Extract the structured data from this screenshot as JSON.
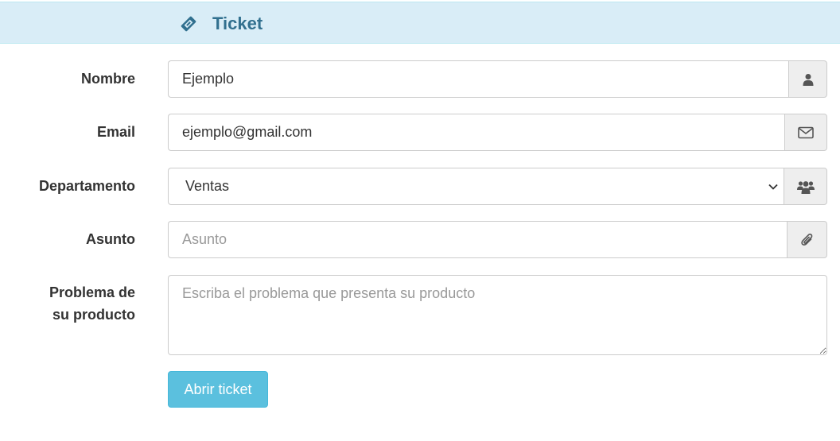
{
  "header": {
    "title": "Ticket",
    "icon": "ticket-icon",
    "background": "#d9edf7",
    "title_color": "#31708f"
  },
  "form": {
    "nombre": {
      "label": "Nombre",
      "value": "Ejemplo",
      "icon": "user-icon"
    },
    "email": {
      "label": "Email",
      "value": "ejemplo@gmail.com",
      "icon": "envelope-icon"
    },
    "departamento": {
      "label": "Departamento",
      "selected": "Ventas",
      "icon": "users-icon"
    },
    "asunto": {
      "label": "Asunto",
      "placeholder": "Asunto",
      "icon": "paperclip-icon"
    },
    "problema": {
      "label_line1": "Problema de",
      "label_line2": "su producto",
      "placeholder": "Escriba el problema que presenta su producto"
    },
    "submit_label": "Abrir ticket",
    "button_color": "#5bc0de"
  }
}
